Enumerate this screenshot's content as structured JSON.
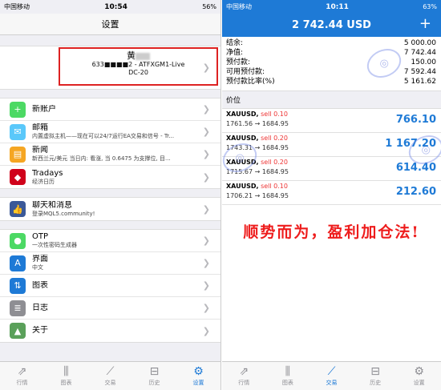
{
  "left": {
    "status": {
      "carrier": "中国移动",
      "time": "10:54",
      "battery": "56%"
    },
    "title": "设置",
    "account": {
      "name": "黄",
      "server": "633■■■■2 - ATFXGM1-Live",
      "sub": "DC-20"
    },
    "group1": [
      {
        "icon": "+",
        "color": "#4cd964",
        "title": "新账户",
        "sub": ""
      },
      {
        "icon": "✉",
        "color": "#5ac8fa",
        "title": "邮箱",
        "sub": "内置虚拟主机——现在可以24/7运行EA交易和信号 - Tr..."
      },
      {
        "icon": "▤",
        "color": "#f5a623",
        "title": "新闻",
        "sub": "新西兰元/美元 当日内: 看涨, 当 0.6475 为支撑位, 目..."
      },
      {
        "icon": "◆",
        "color": "#d0021b",
        "title": "Tradays",
        "sub": "经济日历"
      }
    ],
    "group2": [
      {
        "icon": "👍",
        "color": "#3b5998",
        "title": "聊天和消息",
        "sub": "登录MQL5.community!"
      }
    ],
    "group3": [
      {
        "icon": "●",
        "color": "#4cd964",
        "title": "OTP",
        "sub": "一次性密码生成器"
      },
      {
        "icon": "A",
        "color": "#1e7ad6",
        "title": "界面",
        "sub": "中文"
      },
      {
        "icon": "⇅",
        "color": "#1e7ad6",
        "title": "图表",
        "sub": ""
      },
      {
        "icon": "≣",
        "color": "#8e8e93",
        "title": "日志",
        "sub": ""
      },
      {
        "icon": "▲",
        "color": "#5aa05a",
        "title": "关于",
        "sub": ""
      }
    ],
    "tabs": [
      {
        "icon": "⇗",
        "label": "行情"
      },
      {
        "icon": "⫼",
        "label": "图表"
      },
      {
        "icon": "⟋",
        "label": "交易"
      },
      {
        "icon": "⊟",
        "label": "历史"
      },
      {
        "icon": "⚙",
        "label": "设置"
      }
    ]
  },
  "right": {
    "status": {
      "carrier": "中国移动",
      "time": "10:11",
      "battery": "63%"
    },
    "title": "2 742.44 USD",
    "plus": "+",
    "balances": [
      {
        "label": "结余:",
        "value": "5 000.00"
      },
      {
        "label": "净值:",
        "value": "7 742.44"
      },
      {
        "label": "预付款:",
        "value": "150.00"
      },
      {
        "label": "可用预付款:",
        "value": "7 592.44"
      },
      {
        "label": "预付款比率(%)",
        "value": "5 161.62"
      }
    ],
    "section": "价位",
    "positions": [
      {
        "symbol": "XAUUSD,",
        "side": "sell 0.10",
        "prices": "1761.56 → 1684.95",
        "profit": "766.10"
      },
      {
        "symbol": "XAUUSD,",
        "side": "sell 0.20",
        "prices": "1743.31 → 1684.95",
        "profit": "1 167.20"
      },
      {
        "symbol": "XAUUSD,",
        "side": "sell 0.20",
        "prices": "1715.67 → 1684.95",
        "profit": "614.40"
      },
      {
        "symbol": "XAUUSD,",
        "side": "sell 0.10",
        "prices": "1706.21 → 1684.95",
        "profit": "212.60"
      }
    ],
    "slogan": "顺势而为，盈利加仓法!",
    "tabs": [
      {
        "icon": "⇗",
        "label": "行情"
      },
      {
        "icon": "⫼",
        "label": "图表"
      },
      {
        "icon": "⟋",
        "label": "交易"
      },
      {
        "icon": "⊟",
        "label": "历史"
      },
      {
        "icon": "⚙",
        "label": "设置"
      }
    ]
  }
}
